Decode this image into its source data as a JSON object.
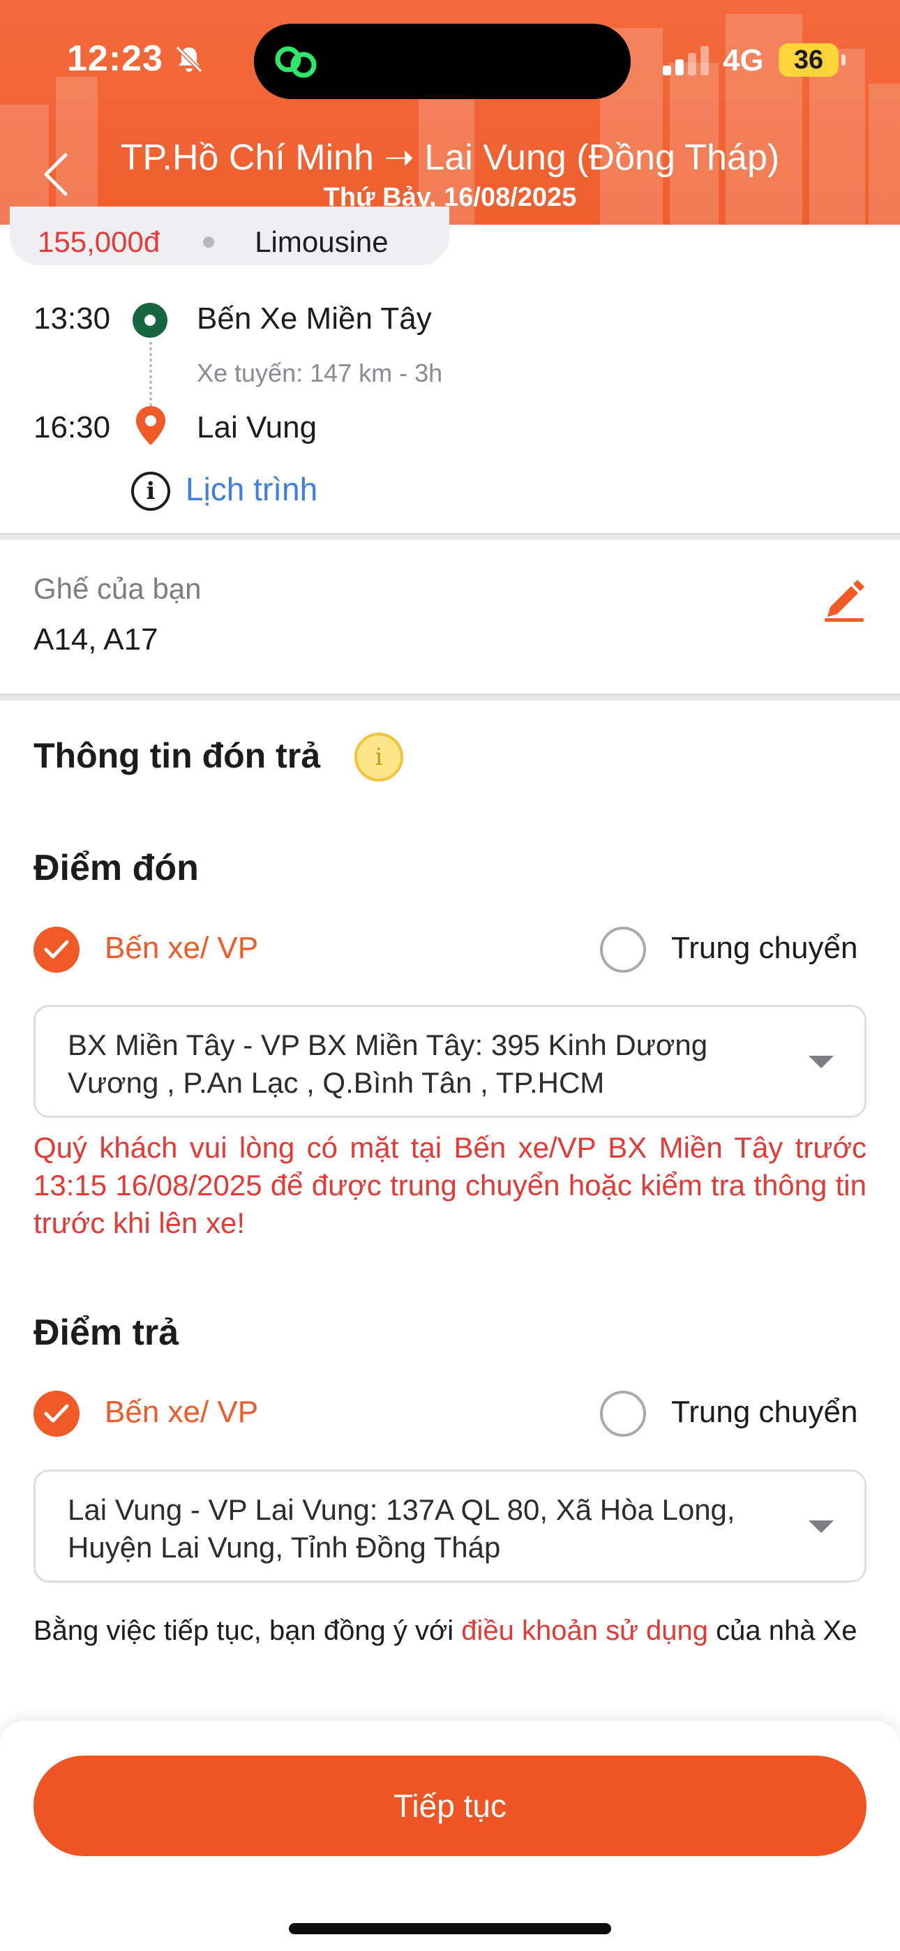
{
  "status_bar": {
    "time": "12:23",
    "network": "4G",
    "battery": "36"
  },
  "header": {
    "route": "TP.Hồ Chí Minh ➝ Lai Vung (Đồng Tháp)",
    "date": "Thứ Bảy, 16/08/2025"
  },
  "trip": {
    "price": "155,000đ",
    "bus_type": "Limousine",
    "departure_time": "13:30",
    "departure_stop": "Bến Xe Miền Tây",
    "route_info": "Xe tuyến: 147 km - 3h",
    "arrival_time": "16:30",
    "arrival_stop": "Lai Vung",
    "schedule_link": "Lịch trình"
  },
  "seats": {
    "label": "Ghế của bạn",
    "value": "A14, A17"
  },
  "pickup_dropoff": {
    "section_title": "Thông tin đón trả",
    "pickup": {
      "title": "Điểm đón",
      "option_selected": "Bến xe/ VP",
      "option_other": "Trung chuyển",
      "location": "BX Miền Tây - VP BX Miền Tây: 395 Kinh Dương Vương , P.An Lạc , Q.Bình Tân , TP.HCM",
      "notice": "Quý khách vui lòng có mặt tại Bến xe/VP BX Miền Tây trước 13:15 16/08/2025 để được trung chuyển hoặc kiểm tra thông tin trước khi lên xe!"
    },
    "dropoff": {
      "title": "Điểm trả",
      "option_selected": "Bến xe/ VP",
      "option_other": "Trung chuyển",
      "location": "Lai Vung - VP Lai Vung: 137A QL 80, Xã Hòa Long, Huyện Lai Vung, Tỉnh Đồng Tháp"
    }
  },
  "terms": {
    "prefix": "Bằng việc tiếp tục, bạn đồng ý với ",
    "link": "điều khoản sử dụng",
    "suffix": " của nhà Xe"
  },
  "actions": {
    "continue_label": "Tiếp tục"
  },
  "colors": {
    "brand_orange": "#ef5a26",
    "warning_red": "#e53935",
    "link_blue": "#3f7fe3",
    "start_green": "#17663f"
  }
}
